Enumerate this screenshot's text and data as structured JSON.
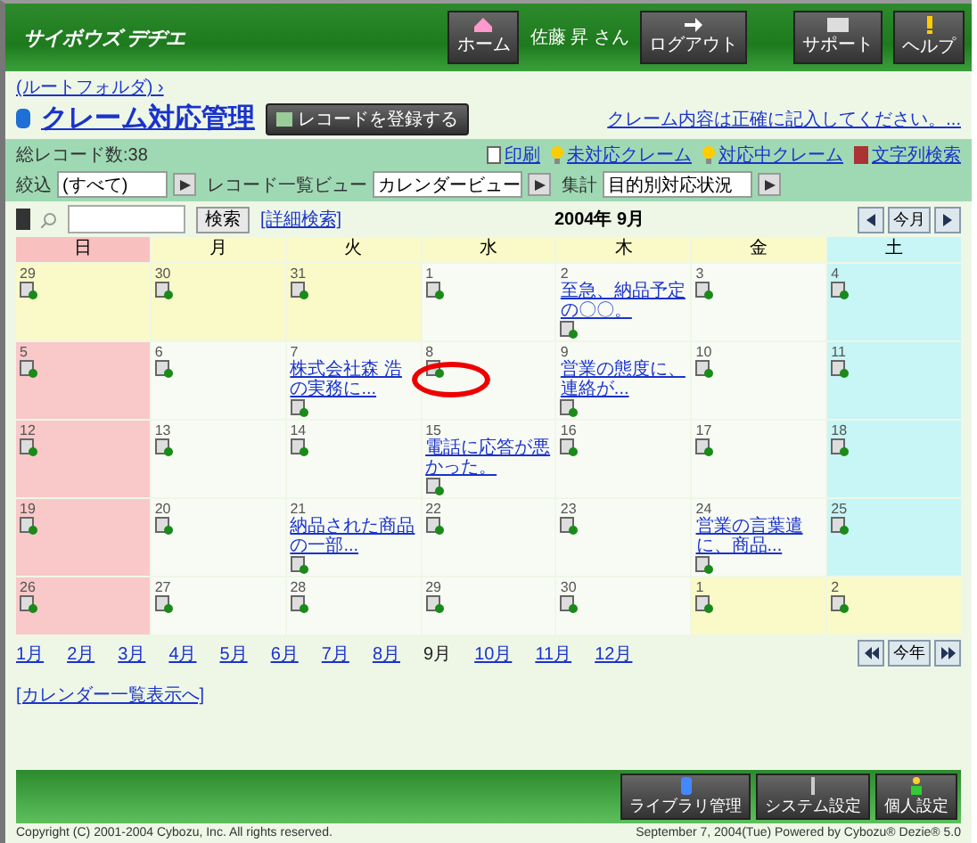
{
  "header": {
    "logo": "サイボウズ デヂエ",
    "home_button": "ホーム",
    "user": "佐藤 昇 さん",
    "buttons": [
      {
        "label": "ログアウト",
        "kind": "logout"
      },
      {
        "label": "サポート",
        "kind": "support"
      },
      {
        "label": "ヘルプ",
        "kind": "help"
      }
    ]
  },
  "breadcrumb": "(ルートフォルダ) ›",
  "title": "クレーム対応管理",
  "register_button": "レコードを登録する",
  "notice": "クレーム内容は正確に記入してください。...",
  "record_count": "総レコード数:38",
  "actions": [
    {
      "label": "印刷",
      "kind": "print"
    },
    {
      "label": "未対応クレーム",
      "kind": "bulb"
    },
    {
      "label": "対応中クレーム",
      "kind": "bulb"
    },
    {
      "label": "文字列検索",
      "kind": "search"
    }
  ],
  "filters": [
    {
      "label": "絞込",
      "value": "(すべて)"
    },
    {
      "label": "レコード一覧ビュー",
      "value": "カレンダービュー"
    },
    {
      "label": "集計",
      "value": "目的別対応状況"
    }
  ],
  "search": {
    "button": "検索",
    "advanced": "[詳細検索]"
  },
  "month_title": "2004年 9月",
  "month_nav": "今月",
  "weekdays": [
    "日",
    "月",
    "火",
    "水",
    "木",
    "金",
    "土"
  ],
  "weeks": [
    [
      {
        "day": "29",
        "in_month": false
      },
      {
        "day": "30",
        "in_month": false
      },
      {
        "day": "31",
        "in_month": false
      },
      {
        "day": "1",
        "in_month": true
      },
      {
        "day": "2",
        "in_month": true,
        "event": "至急、納品予定の〇〇。"
      },
      {
        "day": "3",
        "in_month": true
      },
      {
        "day": "4",
        "in_month": true
      }
    ],
    [
      {
        "day": "5",
        "in_month": true
      },
      {
        "day": "6",
        "in_month": true
      },
      {
        "day": "7",
        "in_month": true,
        "event": "株式会社森 浩の実務に..."
      },
      {
        "day": "8",
        "in_month": true,
        "annotated": true
      },
      {
        "day": "9",
        "in_month": true,
        "event": "営業の態度に、連絡が..."
      },
      {
        "day": "10",
        "in_month": true
      },
      {
        "day": "11",
        "in_month": true
      }
    ],
    [
      {
        "day": "12",
        "in_month": true
      },
      {
        "day": "13",
        "in_month": true
      },
      {
        "day": "14",
        "in_month": true
      },
      {
        "day": "15",
        "in_month": true,
        "event": "電話に応答が悪かった。"
      },
      {
        "day": "16",
        "in_month": true
      },
      {
        "day": "17",
        "in_month": true
      },
      {
        "day": "18",
        "in_month": true
      }
    ],
    [
      {
        "day": "19",
        "in_month": true
      },
      {
        "day": "20",
        "in_month": true
      },
      {
        "day": "21",
        "in_month": true,
        "event": "納品された商品の一部..."
      },
      {
        "day": "22",
        "in_month": true
      },
      {
        "day": "23",
        "in_month": true
      },
      {
        "day": "24",
        "in_month": true,
        "event": "営業の言葉遣に、商品..."
      },
      {
        "day": "25",
        "in_month": true
      }
    ],
    [
      {
        "day": "26",
        "in_month": true
      },
      {
        "day": "27",
        "in_month": true
      },
      {
        "day": "28",
        "in_month": true
      },
      {
        "day": "29",
        "in_month": true
      },
      {
        "day": "30",
        "in_month": true
      },
      {
        "day": "1",
        "in_month": false
      },
      {
        "day": "2",
        "in_month": false
      }
    ]
  ],
  "months": [
    {
      "label": "1月",
      "selected": false
    },
    {
      "label": "2月",
      "selected": false
    },
    {
      "label": "3月",
      "selected": false
    },
    {
      "label": "4月",
      "selected": false
    },
    {
      "label": "5月",
      "selected": false
    },
    {
      "label": "6月",
      "selected": false
    },
    {
      "label": "7月",
      "selected": false
    },
    {
      "label": "8月",
      "selected": false
    },
    {
      "label": "9月",
      "selected": true
    },
    {
      "label": "10月",
      "selected": false
    },
    {
      "label": "11月",
      "selected": false
    },
    {
      "label": "12月",
      "selected": false
    }
  ],
  "year_nav": "今年",
  "list_link": "[カレンダー一覧表示へ]",
  "footer_buttons": [
    {
      "label": "ライブラリ管理",
      "kind": "library"
    },
    {
      "label": "システム設定",
      "kind": "system"
    },
    {
      "label": "個人設定",
      "kind": "person"
    }
  ],
  "copyright": "Copyright (C) 2001-2004 Cybozu, Inc. All rights reserved.",
  "date_line": "September 7, 2004(Tue)   Powered by Cybozu® Dezie® 5.0"
}
